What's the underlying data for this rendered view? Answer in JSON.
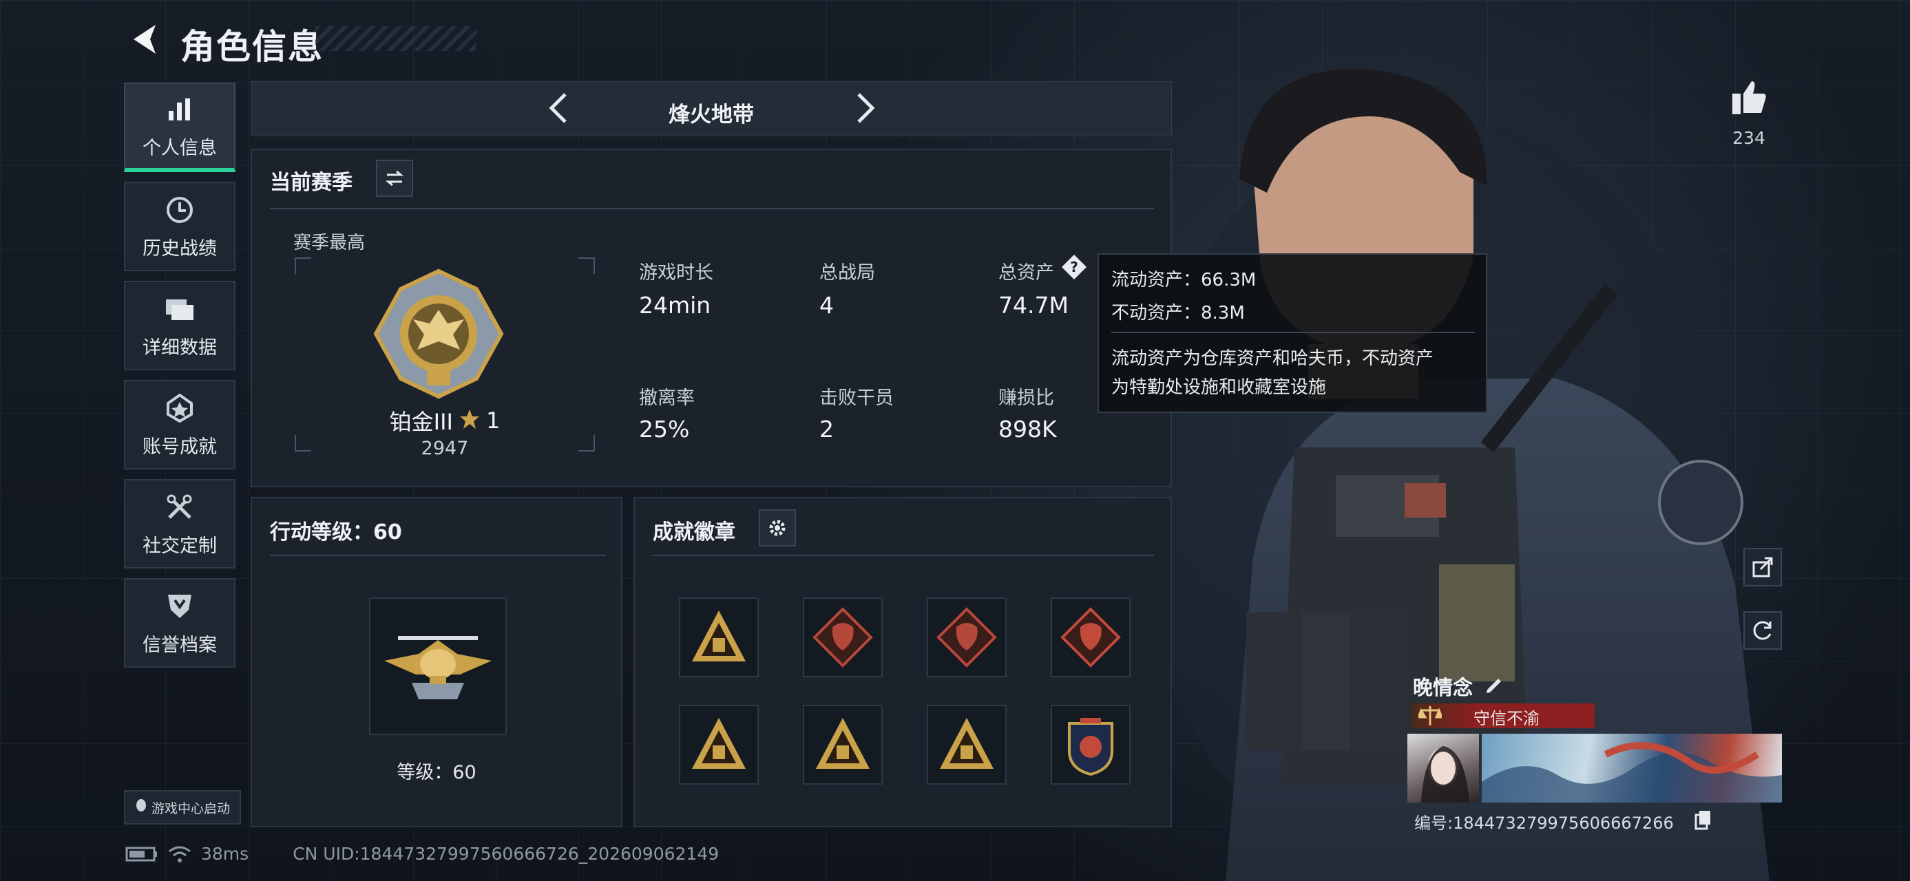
{
  "header": {
    "title": "角色信息"
  },
  "nav": {
    "items": [
      {
        "label": "个人信息",
        "icon": "bar-chart-icon"
      },
      {
        "label": "历史战绩",
        "icon": "history-icon"
      },
      {
        "label": "详细数据",
        "icon": "folder-icon"
      },
      {
        "label": "账号成就",
        "icon": "achievement-icon"
      },
      {
        "label": "社交定制",
        "icon": "tools-icon"
      },
      {
        "label": "信誉档案",
        "icon": "shield-icon"
      }
    ],
    "launch_label": "游戏中心启动"
  },
  "mode": {
    "name": "烽火地带"
  },
  "season": {
    "title": "当前赛季",
    "best_label": "赛季最高",
    "rank_name": "铂金III",
    "rank_stars": "1",
    "rank_score": "2947",
    "stats": [
      {
        "label": "游戏时长",
        "value": "24min"
      },
      {
        "label": "总战局",
        "value": "4"
      },
      {
        "label": "总资产",
        "value": "74.7M"
      },
      {
        "label": "撤离率",
        "value": "25%"
      },
      {
        "label": "击败干员",
        "value": "2"
      },
      {
        "label": "赚损比",
        "value": "898K"
      }
    ]
  },
  "tooltip": {
    "line1": "流动资产：66.3M",
    "line2": "不动资产：8.3M",
    "desc1": "流动资产为仓库资产和哈夫币，不动资产",
    "desc2": "为特勤处设施和收藏室设施"
  },
  "level": {
    "title": "行动等级：60",
    "level_label": "等级：60"
  },
  "badges": {
    "title": "成就徽章",
    "items": [
      "badge-1",
      "badge-2",
      "badge-3",
      "badge-4",
      "badge-5",
      "badge-6",
      "badge-7",
      "badge-8"
    ]
  },
  "profile": {
    "likes": "234",
    "name": "晚情念",
    "tag": "守信不渝",
    "id_text": "编号:1844732799756066672​66"
  },
  "status": {
    "ping": "38ms",
    "uid": "CN UID:18447327997560666726_202609062149"
  },
  "colors": {
    "accent": "#2bd39b",
    "gold": "#c9a24a",
    "tag_red": "#8c1f1f"
  }
}
